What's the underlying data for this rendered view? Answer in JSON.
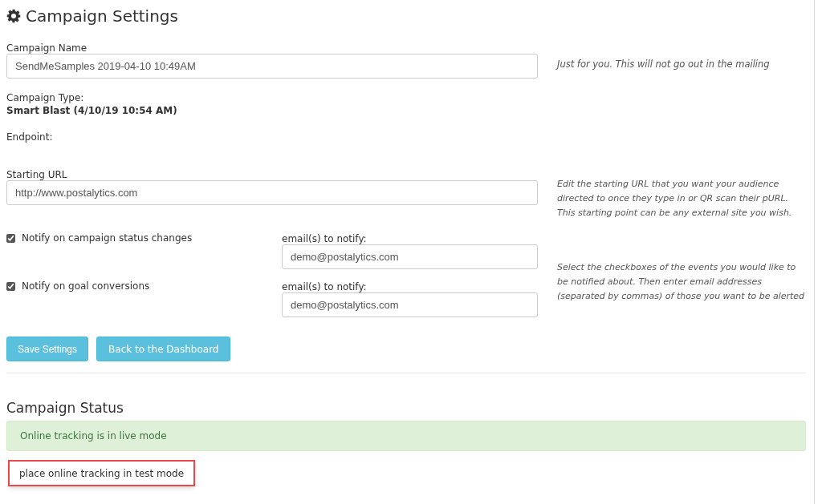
{
  "title": "Campaign Settings",
  "campaign_name": {
    "label": "Campaign Name",
    "value": "SendMeSamples 2019-04-10 10:49AM",
    "help": "Just for you. This will not go out in the mailing"
  },
  "campaign_type": {
    "label": "Campaign Type:",
    "value": "Smart Blast (4/10/19 10:54 AM)"
  },
  "endpoint": {
    "label": "Endpoint:"
  },
  "starting_url": {
    "label": "Starting URL",
    "value": "http://www.postalytics.com",
    "help": "Edit the starting URL that you want your audience directed to once they type in or QR scan their pURL. This starting point can be any external site you wish."
  },
  "notifications": [
    {
      "label": "Notify on campaign status changes",
      "checked": true,
      "email_label": "email(s) to notify:",
      "email": "demo@postalytics.com"
    },
    {
      "label": "Notify on goal conversions",
      "checked": true,
      "email_label": "email(s) to notify:",
      "email": "demo@postalytics.com"
    }
  ],
  "notifications_help": "Select the checkboxes of the events you would like to be notified about. Then enter email addresses (separated by commas) of those you want to be alerted",
  "buttons": [
    "Save Settings",
    "Back to the Dashboard"
  ],
  "status": {
    "heading": "Campaign Status",
    "alert": "Online tracking is in live mode",
    "action": "place online tracking in test mode"
  }
}
